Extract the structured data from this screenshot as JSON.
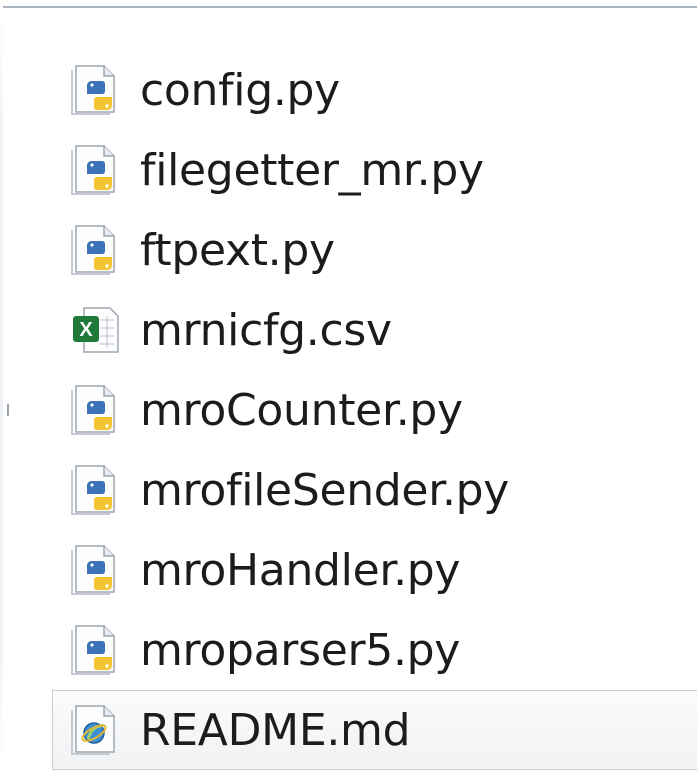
{
  "files": [
    {
      "name": "config.py",
      "icon": "python-file-icon",
      "selected": false
    },
    {
      "name": "filegetter_mr.py",
      "icon": "python-file-icon",
      "selected": false
    },
    {
      "name": "ftpext.py",
      "icon": "python-file-icon",
      "selected": false
    },
    {
      "name": "mrnicfg.csv",
      "icon": "excel-csv-file-icon",
      "selected": false
    },
    {
      "name": "mroCounter.py",
      "icon": "python-file-icon",
      "selected": false
    },
    {
      "name": "mrofileSender.py",
      "icon": "python-file-icon",
      "selected": false
    },
    {
      "name": "mroHandler.py",
      "icon": "python-file-icon",
      "selected": false
    },
    {
      "name": "mroparser5.py",
      "icon": "python-file-icon",
      "selected": false
    },
    {
      "name": "README.md",
      "icon": "markdown-file-icon",
      "selected": true
    }
  ],
  "colors": {
    "python_blue": "#3b72b8",
    "python_yellow": "#f2c531",
    "excel_green": "#1f7a3a",
    "text": "#1c1c1c",
    "selection_border": "#c9cdd2"
  }
}
